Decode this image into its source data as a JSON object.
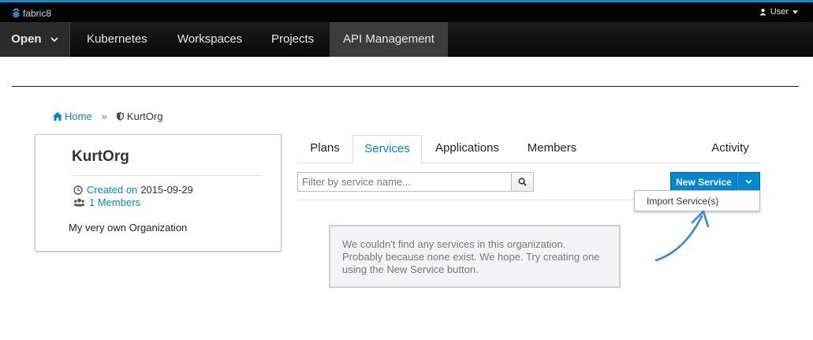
{
  "app": {
    "logo_text": "fabric8"
  },
  "user_menu": {
    "label": "User"
  },
  "nav": {
    "open": "Open",
    "items": [
      "Kubernetes",
      "Workspaces",
      "Projects",
      "API Management"
    ]
  },
  "breadcrumb": {
    "home": "Home",
    "separator": "»",
    "org": "KurtOrg"
  },
  "org": {
    "name": "KurtOrg",
    "created_label": "Created on",
    "created_date": "2015-09-29",
    "members_label": "1 Members",
    "description": "My very own Organization"
  },
  "tabs": {
    "plans": "Plans",
    "services": "Services",
    "applications": "Applications",
    "members": "Members",
    "activity": "Activity",
    "active": "Services"
  },
  "search": {
    "placeholder": "Filter by service name...",
    "value": ""
  },
  "new_service": {
    "label": "New Service"
  },
  "dropdown": {
    "import_label": "Import Service(s)"
  },
  "empty": {
    "message": "We couldn't find any services in this organization. Probably because none exist. We hope. Try creating one using the New Service button."
  },
  "colors": {
    "accent": "#0088ce",
    "topbar_border": "#0e8ed2",
    "navbar_bg": "#0a0a0a",
    "arrow": "#3a86d8"
  },
  "icons": [
    "fabric8-logo-icon",
    "user-icon",
    "caret-down-icon",
    "chevron-down-icon",
    "home-icon",
    "shield-icon",
    "clock-icon",
    "users-icon",
    "search-icon",
    "curved-arrow-icon"
  ]
}
